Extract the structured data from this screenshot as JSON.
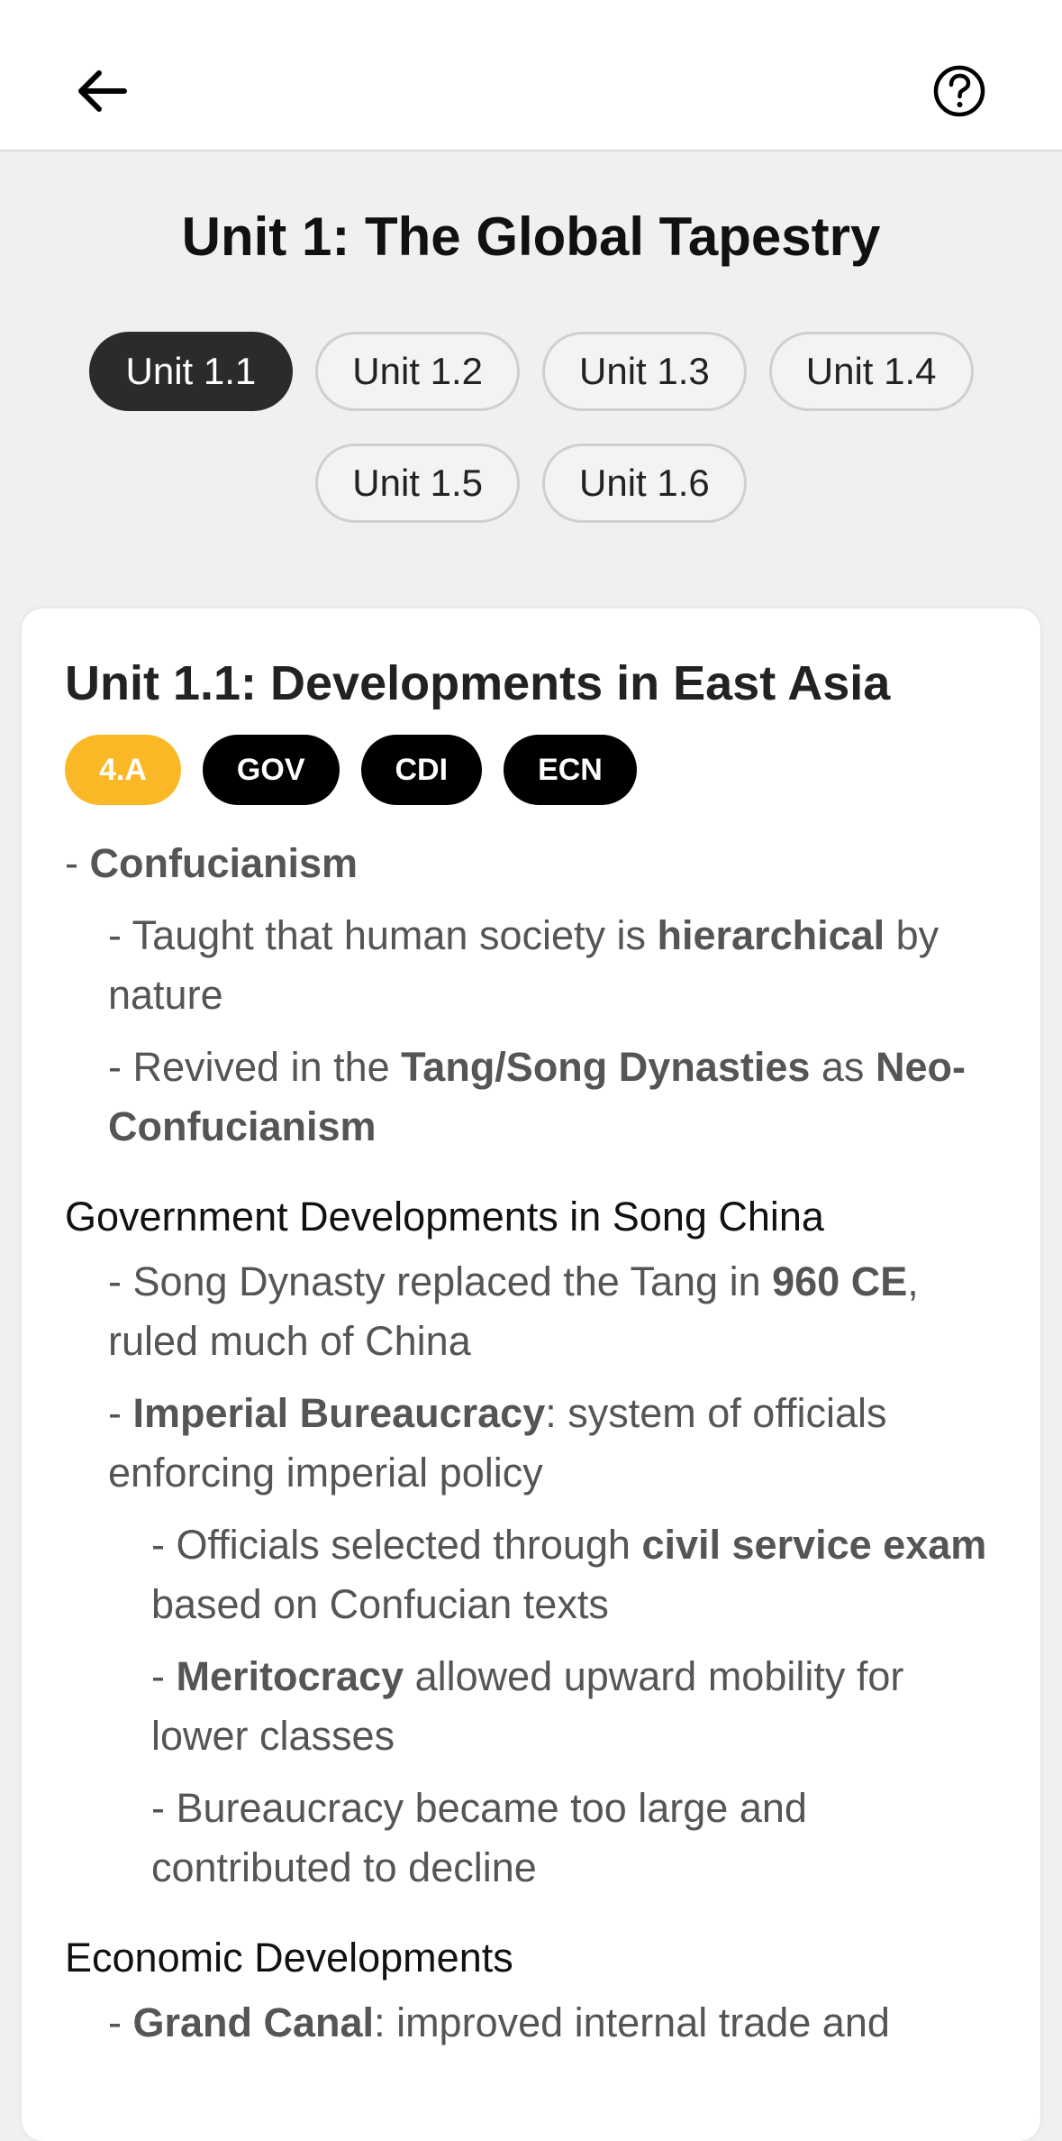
{
  "header": {
    "back_icon": "arrow-left-icon",
    "help_icon": "question-circle-icon"
  },
  "page_title": "Unit 1: The Global Tapestry",
  "units": [
    "Unit 1.1",
    "Unit 1.2",
    "Unit 1.3",
    "Unit 1.4",
    "Unit 1.5",
    "Unit 1.6"
  ],
  "active_unit": "Unit 1.1",
  "card": {
    "title": "Unit 1.1: Developments in East Asia",
    "tags": [
      {
        "label": "4.A",
        "color": "#fbb826"
      },
      {
        "label": "GOV",
        "color": "#000000"
      },
      {
        "label": "CDI",
        "color": "#000000"
      },
      {
        "label": "ECN",
        "color": "#000000"
      }
    ],
    "notes": {
      "confucianism": {
        "prefix": "- ",
        "label": "Confucianism"
      },
      "n1": {
        "a": "- Taught that human society is ",
        "b": "hierarchical",
        "c": " by nature"
      },
      "n2": {
        "a": "- Revived in the ",
        "b": "Tang/Song Dynasties",
        "c": " as ",
        "d": "Neo-Confucianism"
      },
      "heading_gov": "Government Developments in Song China",
      "n3": {
        "a": "- Song Dynasty replaced the Tang in ",
        "b": "960 CE",
        "c": ", ruled much of China"
      },
      "n4": {
        "a": "- ",
        "b": "Imperial Bureaucracy",
        "c": ": system of officials enforcing imperial policy"
      },
      "n5": {
        "a": "- Officials selected through ",
        "b": "civil service exam",
        "c": " based on Confucian texts"
      },
      "n6": {
        "a": "- ",
        "b": "Meritocracy",
        "c": " allowed upward mobility for lower classes"
      },
      "n7": "- Bureaucracy became too large and contributed to decline",
      "heading_econ": "Economic Developments",
      "n8": {
        "a": "- ",
        "b": "Grand Canal",
        "c": ": improved internal trade and"
      }
    }
  }
}
